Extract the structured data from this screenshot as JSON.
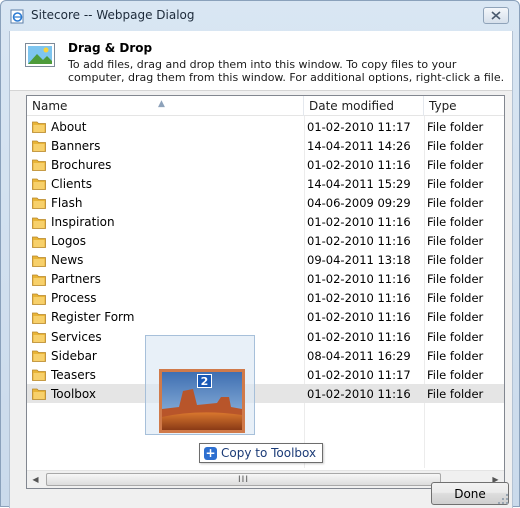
{
  "window": {
    "title": "Sitecore -- Webpage Dialog",
    "close_label": "✕"
  },
  "header": {
    "title": "Drag & Drop",
    "description": "To add files, drag and drop them into this window. To copy files to your computer, drag them from this window. For additional options, right-click a file."
  },
  "columns": {
    "name": "Name",
    "date": "Date modified",
    "type": "Type"
  },
  "files": [
    {
      "name": "About",
      "date": "01-02-2010 11:17",
      "type": "File folder"
    },
    {
      "name": "Banners",
      "date": "14-04-2011 14:26",
      "type": "File folder"
    },
    {
      "name": "Brochures",
      "date": "01-02-2010 11:16",
      "type": "File folder"
    },
    {
      "name": "Clients",
      "date": "14-04-2011 15:29",
      "type": "File folder"
    },
    {
      "name": "Flash",
      "date": "04-06-2009 09:29",
      "type": "File folder"
    },
    {
      "name": "Inspiration",
      "date": "01-02-2010 11:16",
      "type": "File folder"
    },
    {
      "name": "Logos",
      "date": "01-02-2010 11:16",
      "type": "File folder"
    },
    {
      "name": "News",
      "date": "09-04-2011 13:18",
      "type": "File folder"
    },
    {
      "name": "Partners",
      "date": "01-02-2010 11:16",
      "type": "File folder"
    },
    {
      "name": "Process",
      "date": "01-02-2010 11:16",
      "type": "File folder"
    },
    {
      "name": "Register Form",
      "date": "01-02-2010 11:16",
      "type": "File folder"
    },
    {
      "name": "Services",
      "date": "01-02-2010 11:16",
      "type": "File folder"
    },
    {
      "name": "Sidebar",
      "date": "08-04-2011 16:29",
      "type": "File folder"
    },
    {
      "name": "Teasers",
      "date": "01-02-2010 11:17",
      "type": "File folder"
    },
    {
      "name": "Toolbox",
      "date": "01-02-2010 11:16",
      "type": "File folder"
    }
  ],
  "selected_index": 14,
  "drag": {
    "count": "2",
    "tooltip": "Copy to Toolbox"
  },
  "scrollbar": {
    "thumb_grip": "III"
  },
  "buttons": {
    "done": "Done"
  },
  "colors": {
    "folder": "#e8b437",
    "selection": "#e5e5e5",
    "accent": "#1a59b6"
  }
}
